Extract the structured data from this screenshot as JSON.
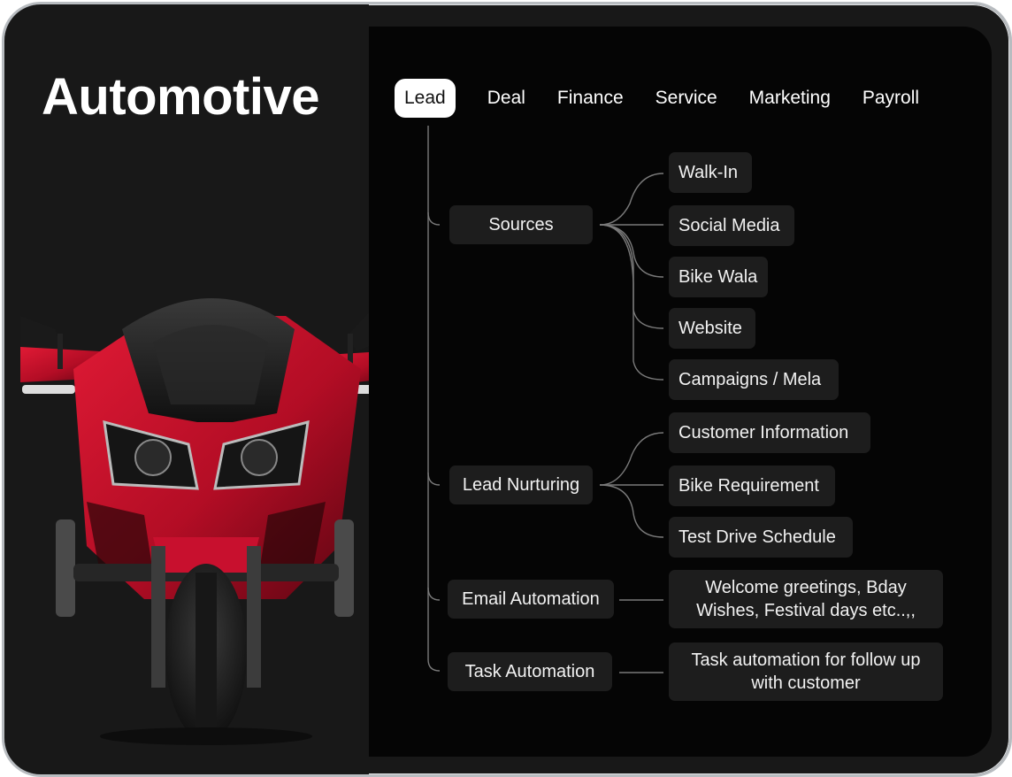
{
  "page_title": "Automotive",
  "tabs": [
    {
      "label": "Lead",
      "active": true
    },
    {
      "label": "Deal",
      "active": false
    },
    {
      "label": "Finance",
      "active": false
    },
    {
      "label": "Service",
      "active": false
    },
    {
      "label": "Marketing",
      "active": false
    },
    {
      "label": "Payroll",
      "active": false
    }
  ],
  "tree": {
    "sources": {
      "label": "Sources",
      "children": [
        "Walk-In",
        "Social Media",
        "Bike Wala",
        "Website",
        "Campaigns / Mela"
      ]
    },
    "nurturing": {
      "label": "Lead Nurturing",
      "children": [
        "Customer Information",
        "Bike Requirement",
        "Test Drive Schedule"
      ]
    },
    "email": {
      "label": "Email Automation",
      "detail": "Welcome greetings, Bday Wishes, Festival days etc..,,"
    },
    "task": {
      "label": "Task Automation",
      "detail": "Task automation for follow up with customer"
    }
  },
  "colors": {
    "frame_bg": "#181818",
    "panel_bg": "#050505",
    "node_bg": "#1d1d1d",
    "connector": "#8a8a8a",
    "bike_red": "#c8102e"
  },
  "illustration": "motorcycle-front-view"
}
